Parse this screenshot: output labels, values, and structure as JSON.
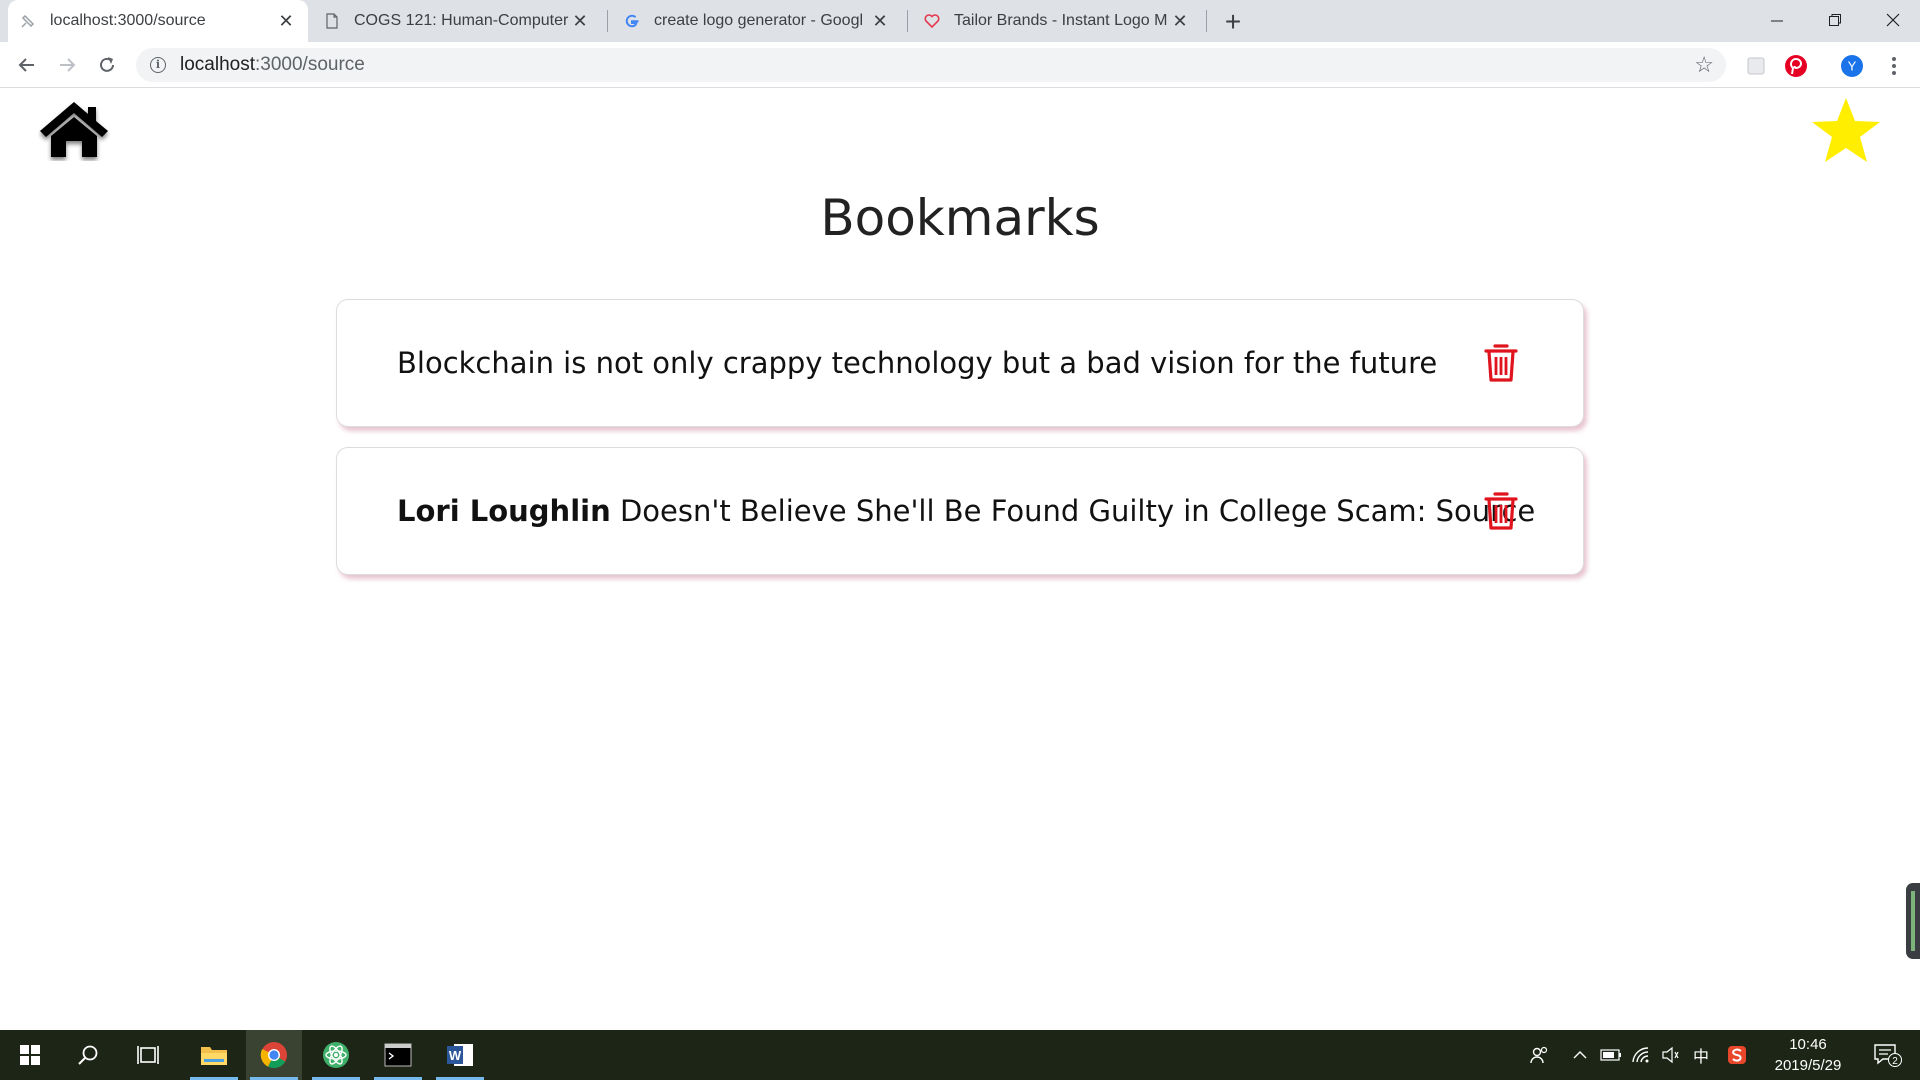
{
  "browser": {
    "tabs": [
      {
        "title": "localhost:3000/source",
        "active": true
      },
      {
        "title": "COGS 121: Human-Computer",
        "active": false
      },
      {
        "title": "create logo generator - Googl",
        "active": false
      },
      {
        "title": "Tailor Brands - Instant Logo M",
        "active": false
      }
    ],
    "address": {
      "host": "localhost",
      "path": ":3000/source"
    },
    "profile_initial": "Y"
  },
  "page": {
    "title": "Bookmarks",
    "bookmarks": [
      {
        "bold": "",
        "text": "Blockchain is not only crappy technology but a bad vision for the future"
      },
      {
        "bold": "Lori Loughlin",
        "text": " Doesn't Believe She'll Be Found Guilty in College Scam: Source"
      }
    ]
  },
  "taskbar": {
    "time": "10:46",
    "date": "2019/5/29",
    "ime": "中",
    "notification_count": "2"
  },
  "colors": {
    "accent_star": "#ffee00",
    "trash": "#e0141e",
    "card_shadow": "#d696aa",
    "taskbar": "#1d2616"
  }
}
